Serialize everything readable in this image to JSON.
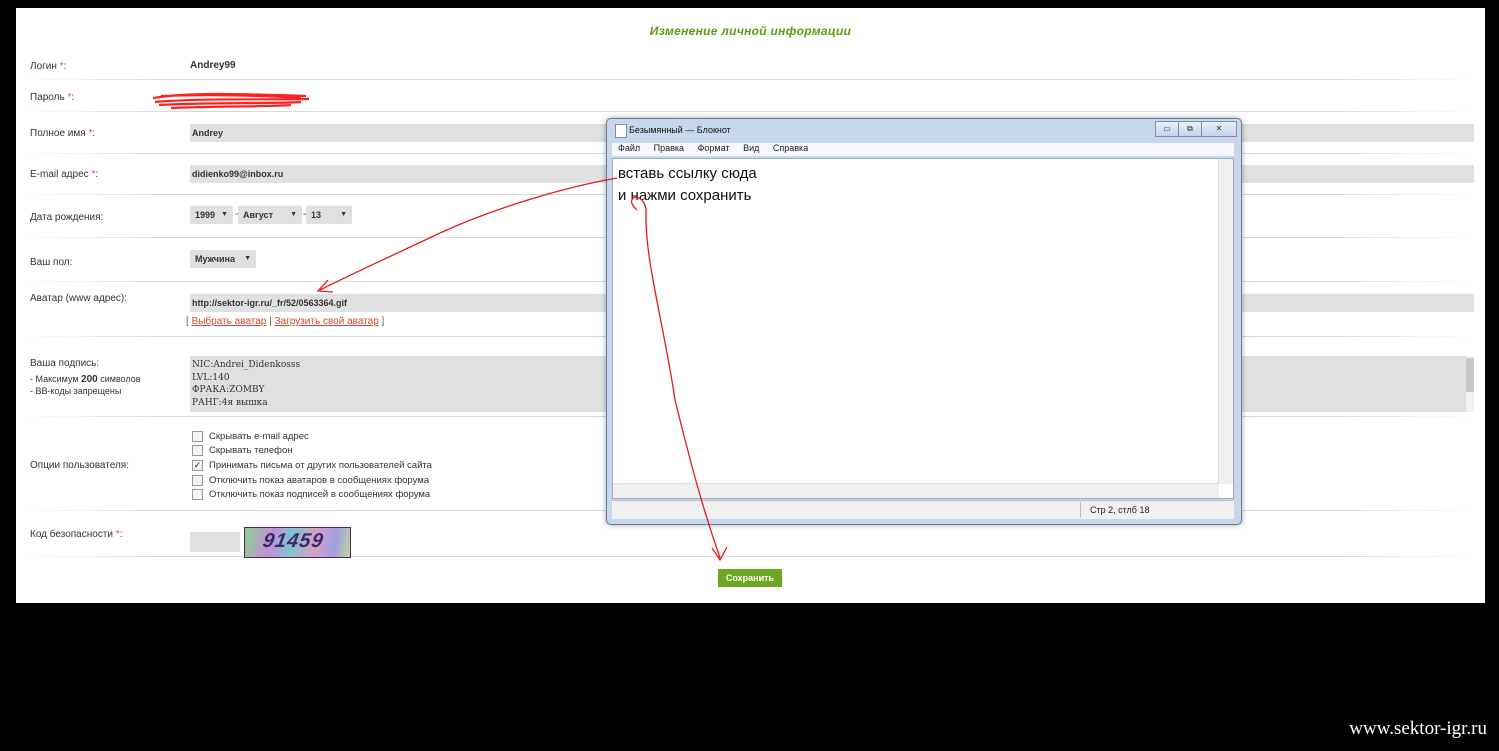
{
  "page": {
    "title": "Изменение личной информации",
    "watermark": "www.sektor-igr.ru"
  },
  "form": {
    "login": {
      "label": "Логин ",
      "req": "*",
      "colon": ":",
      "value": "Andrey99"
    },
    "password": {
      "label": "Пароль ",
      "req": "*",
      "colon": ":"
    },
    "fullname": {
      "label": "Полное имя ",
      "req": "*",
      "colon": ":",
      "value": "Andrey"
    },
    "email": {
      "label": "E-mail адрес ",
      "req": "*",
      "colon": ":",
      "value": "didienko99@inbox.ru"
    },
    "birthdate": {
      "label": "Дата рождения:",
      "year": "1999",
      "month": "Август",
      "day": "13",
      "sep": "-"
    },
    "gender": {
      "label": "Ваш пол:",
      "value": "Мужчина"
    },
    "avatar": {
      "label": "Аватар (www адрес):",
      "value": "http://sektor-igr.ru/_fr/52/0563364.gif",
      "open": "[",
      "choose": "Выбрать аватар",
      "pipe": "|",
      "upload": "Загрузить свой аватар",
      "close": "]"
    },
    "signature": {
      "label": "Ваша подпись:",
      "hint1_prefix": "- Максимум ",
      "hint1_num": "200",
      "hint1_suffix": " символов",
      "hint2": "- BB-коды запрещены",
      "lines": [
        "NIC:Andrei_Didenkosss",
        "LVL:140",
        "ФРАКА:ZOMBY",
        "РАНГ:4я вышка"
      ]
    },
    "options": {
      "label": "Опции пользователя:",
      "items": [
        {
          "text": "Скрывать e-mail адрес",
          "checked": false
        },
        {
          "text": "Скрывать телефон",
          "checked": false
        },
        {
          "text": "Принимать письма от других пользователей сайта",
          "checked": true
        },
        {
          "text": "Отключить показ аватаров в сообщениях форума",
          "checked": false
        },
        {
          "text": "Отключить показ подписей в сообщениях форума",
          "checked": false
        }
      ]
    },
    "captcha": {
      "label": "Код безопасности ",
      "req": "*",
      "colon": ":",
      "image_text": "91459"
    },
    "save": "Сохранить"
  },
  "notepad": {
    "title": "Безымянный — Блокнот",
    "menu": [
      "Файл",
      "Правка",
      "Формат",
      "Вид",
      "Справка"
    ],
    "text_line1": "вставь ссылку сюда",
    "text_line2": "и нажми сохранить",
    "status": "Стр 2, стлб 18"
  },
  "colors": {
    "accent_green": "#6aa821",
    "title_green": "#5e9a14",
    "required_red": "#e04848",
    "link_red": "#d5452b",
    "annotation_red": "#e11b1b"
  }
}
